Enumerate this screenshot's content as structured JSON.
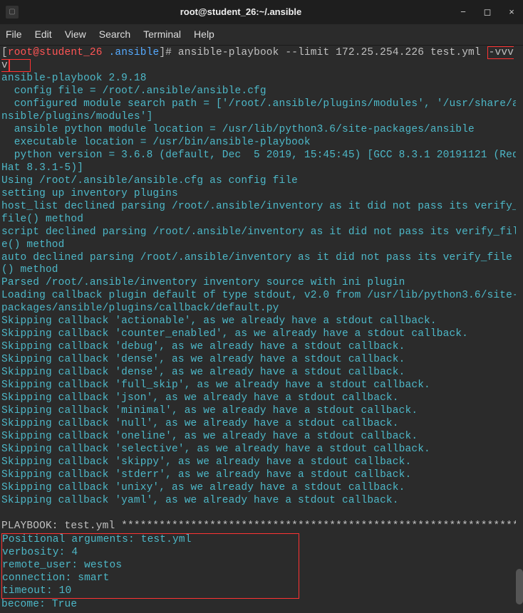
{
  "titlebar": {
    "title": "root@student_26:~/.ansible"
  },
  "window_controls": {
    "minimize": "−",
    "maximize": "◻",
    "close": "×"
  },
  "menubar": {
    "file": "File",
    "edit": "Edit",
    "view": "View",
    "search": "Search",
    "terminal": "Terminal",
    "help": "Help"
  },
  "prompt": {
    "open_bracket": "[",
    "user_host": "root@student_26",
    "space": " ",
    "path": ".ansible",
    "close_bracket": "]",
    "hash": "#"
  },
  "command": {
    "base": "ansible-playbook --limit 172.25.254.226 test.yml ",
    "flag_boxed": "-vvvv"
  },
  "output": {
    "lines": [
      "ansible-playbook 2.9.18",
      "  config file = /root/.ansible/ansible.cfg",
      "  configured module search path = ['/root/.ansible/plugins/modules', '/usr/share/ansible/plugins/modules']",
      "  ansible python module location = /usr/lib/python3.6/site-packages/ansible",
      "  executable location = /usr/bin/ansible-playbook",
      "  python version = 3.6.8 (default, Dec  5 2019, 15:45:45) [GCC 8.3.1 20191121 (Red Hat 8.3.1-5)]",
      "Using /root/.ansible/ansible.cfg as config file",
      "setting up inventory plugins",
      "host_list declined parsing /root/.ansible/inventory as it did not pass its verify_file() method",
      "script declined parsing /root/.ansible/inventory as it did not pass its verify_file() method",
      "auto declined parsing /root/.ansible/inventory as it did not pass its verify_file() method",
      "Parsed /root/.ansible/inventory inventory source with ini plugin",
      "Loading callback plugin default of type stdout, v2.0 from /usr/lib/python3.6/site-packages/ansible/plugins/callback/default.py"
    ],
    "skip_lines": [
      "Skipping callback 'actionable', as we already have a stdout callback.",
      "Skipping callback 'counter_enabled', as we already have a stdout callback.",
      "Skipping callback 'debug', as we already have a stdout callback.",
      "Skipping callback 'dense', as we already have a stdout callback.",
      "Skipping callback 'dense', as we already have a stdout callback.",
      "Skipping callback 'full_skip', as we already have a stdout callback.",
      "Skipping callback 'json', as we already have a stdout callback.",
      "Skipping callback 'minimal', as we already have a stdout callback.",
      "Skipping callback 'null', as we already have a stdout callback.",
      "Skipping callback 'oneline', as we already have a stdout callback.",
      "Skipping callback 'selective', as we already have a stdout callback.",
      "Skipping callback 'skippy', as we already have a stdout callback.",
      "Skipping callback 'stderr', as we already have a stdout callback.",
      "Skipping callback 'unixy', as we already have a stdout callback.",
      "Skipping callback 'yaml', as we already have a stdout callback."
    ],
    "playbook_header": "PLAYBOOK: test.yml ***************************************************************",
    "boxed_lines": [
      "Positional arguments: test.yml",
      "verbosity: 4",
      "remote_user: westos",
      "connection: smart",
      "timeout: 10"
    ],
    "after_box": "become: True"
  }
}
